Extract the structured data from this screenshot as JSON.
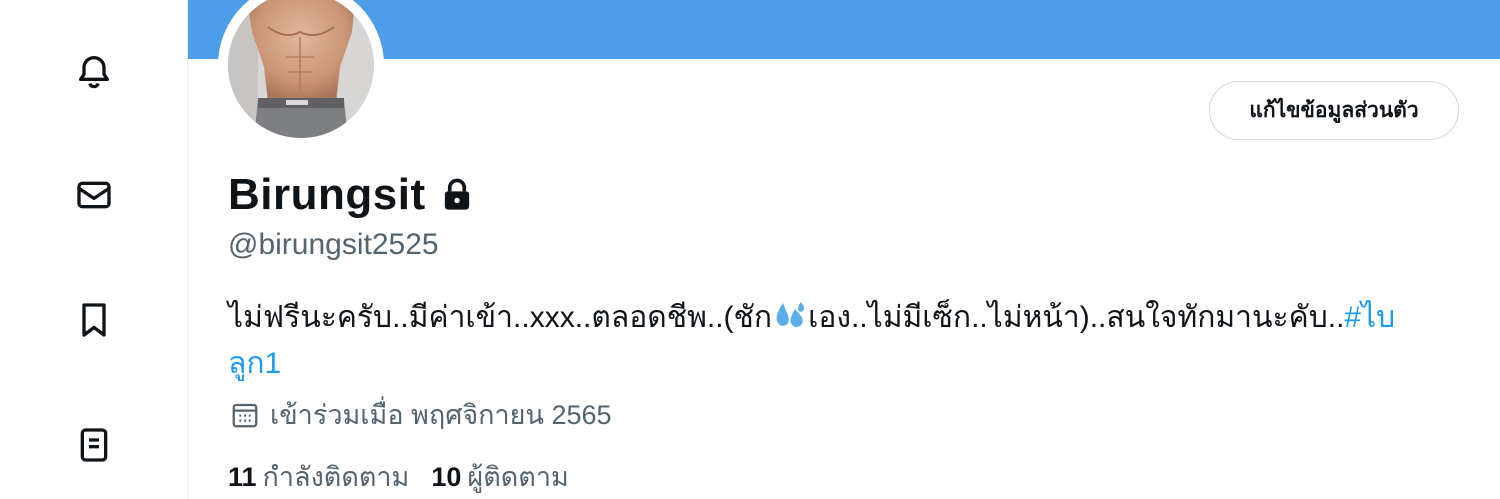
{
  "nav": {
    "items": [
      {
        "icon": "bell-icon",
        "label": ""
      },
      {
        "icon": "envelope-icon",
        "label": ""
      },
      {
        "icon": "bookmark-icon",
        "label": ""
      },
      {
        "icon": "list-icon",
        "label": ""
      }
    ]
  },
  "colors": {
    "banner": "#4d9de8",
    "link": "#1d9bf0",
    "secondary_text": "#536471"
  },
  "profile": {
    "edit_button": "แก้ไขข้อมูลส่วนตัว",
    "display_name": "Birungsit",
    "protected_icon": "lock-icon",
    "handle": "@birungsit2525",
    "bio_part1": "ไม่ฟรีนะครับ..มีค่าเข้า..xxx..ตลอดชีพ..(ชัก",
    "bio_emoji": "sweat-droplets-emoji",
    "bio_part2": "เอง..ไม่มีเซ็ก..ไม่หน้า)..สนใจทักมานะคับ..",
    "bio_hashtag": "#ไบลูก1",
    "joined": "เข้าร่วมเมื่อ พฤศจิกายน 2565",
    "following_count": "11",
    "following_label": "กำลังติดตาม",
    "followers_count": "10",
    "followers_label": "ผู้ติดตาม"
  }
}
